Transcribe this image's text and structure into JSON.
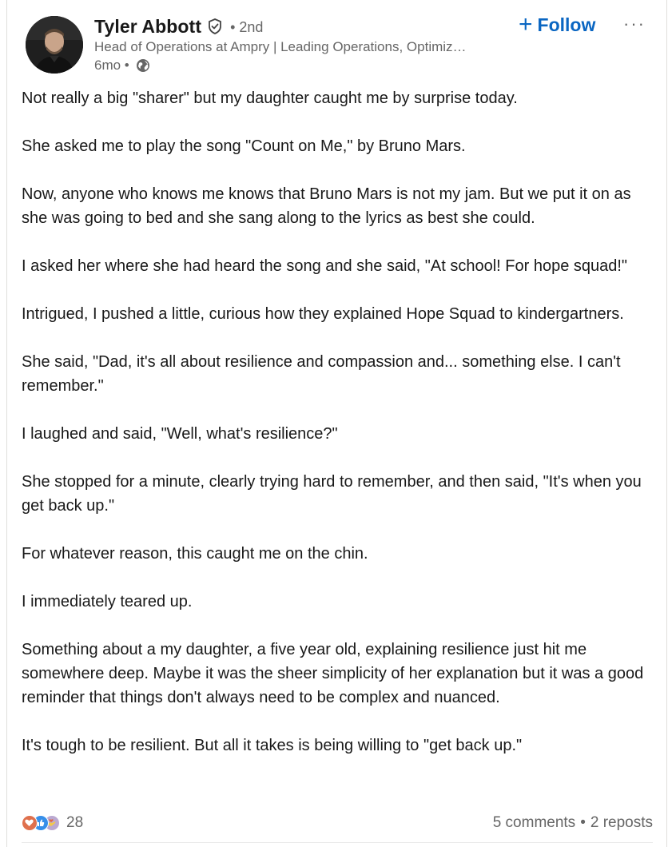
{
  "author": {
    "name": "Tyler Abbott",
    "degree": "• 2nd",
    "headline": "Head of Operations at Ampry | Leading Operations, Optimiz…",
    "time": "6mo •",
    "verified_icon": "verified-shield-icon",
    "visibility_icon": "globe-icon"
  },
  "actions": {
    "follow_label": "Follow",
    "follow_symbol": "+",
    "more_symbol": "···"
  },
  "post": {
    "paragraphs": [
      "Not really a big \"sharer\" but my daughter caught me by surprise today.",
      "She asked me to play the song \"Count on Me,\" by Bruno Mars.",
      "Now, anyone who knows me knows that Bruno Mars is not my jam. But we put it on as she was going to bed and she sang along to the lyrics as best she could.",
      "I asked her where she had heard the song and she said, \"At school! For hope squad!\"",
      "Intrigued, I pushed a little, curious how they explained Hope Squad to kindergartners.",
      "She said, \"Dad, it's all about resilience and compassion and... something else. I can't remember.\"",
      "I laughed and said, \"Well, what's resilience?\"",
      "She stopped for a minute, clearly trying hard to remember, and then said, \"It's when you get back up.\"",
      "For whatever reason, this caught me on the chin.",
      "I immediately teared up.",
      "Something about a my daughter, a five year old, explaining resilience just hit me somewhere deep. Maybe it was the sheer simplicity of her explanation but it was a good reminder that things don't always need to be complex and nuanced.",
      "It's tough to be resilient. But all it takes is being willing to \"get back up.\""
    ]
  },
  "social": {
    "reaction_count": "28",
    "comments": "5 comments",
    "separator": "•",
    "reposts": "2 reposts",
    "reaction_icons": [
      "love-reaction-icon",
      "like-reaction-icon",
      "support-reaction-icon"
    ],
    "colors": {
      "love": "#df704d",
      "like": "#378fe9",
      "support": "#bba9d1"
    }
  },
  "colors": {
    "accent": "#0a66c2",
    "text_primary": "#191919",
    "text_secondary": "#666666"
  }
}
